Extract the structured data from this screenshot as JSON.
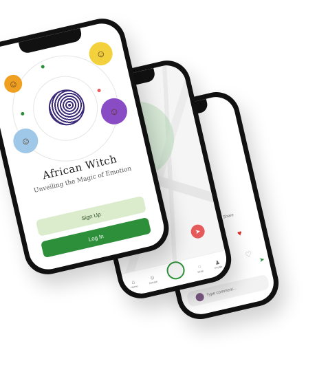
{
  "front_screen": {
    "app_title": "African Witch",
    "tagline": "Unveiling the Magic of Emotion",
    "signup_label": "Sign Up",
    "login_label": "Log In"
  },
  "map_screen": {
    "street_labels": [
      "",
      ""
    ],
    "tabs": [
      {
        "label": "Home",
        "icon": "home-icon"
      },
      {
        "label": "Create",
        "icon": "user-icon"
      },
      {
        "label": "",
        "icon": "center-avatar"
      },
      {
        "label": "Chat",
        "icon": "chat-icon"
      },
      {
        "label": "Profile",
        "icon": "profile-icon"
      }
    ]
  },
  "chat_screen": {
    "share_label": "Share",
    "input_placeholder": "Type comment..."
  },
  "colors": {
    "brand_green": "#2e8f3b",
    "light_green": "#dbeccc",
    "accent_red": "#e55a5a",
    "globe_purple": "#3b2a78"
  }
}
